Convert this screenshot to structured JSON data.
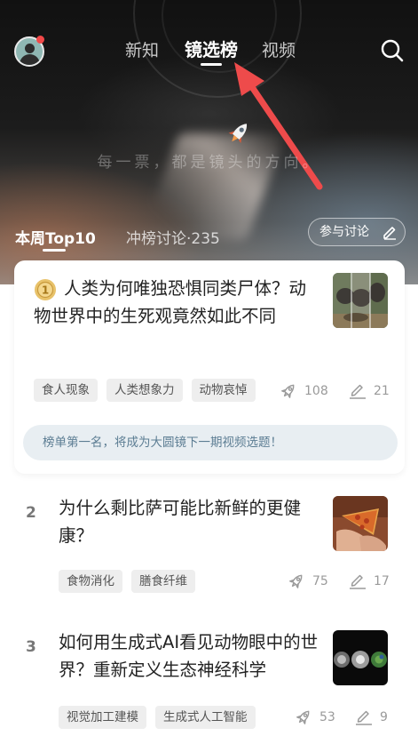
{
  "header": {
    "tabs": [
      {
        "label": "新知",
        "active": false
      },
      {
        "label": "镜选榜",
        "active": true
      },
      {
        "label": "视频",
        "active": false
      }
    ],
    "avatar_icon": "user-avatar",
    "search_icon": "search-icon"
  },
  "hero": {
    "slogan": "每一票，都是镜头的方向。"
  },
  "subtabs": {
    "main": "本周Top10",
    "second": "冲榜讨论·235",
    "join_button": "参与讨论"
  },
  "top_item": {
    "title": "人类为何唯独恐惧同类尸体？动物世界中的生死观竟然如此不同",
    "tags": [
      "食人现象",
      "人类想象力",
      "动物哀悼"
    ],
    "votes": "108",
    "comments": "21",
    "notice": "榜单第一名，将成为大圆镜下一期视频选题！"
  },
  "items": [
    {
      "rank": "2",
      "title": "为什么剩比萨可能比新鲜的更健康？",
      "tags": [
        "食物消化",
        "膳食纤维"
      ],
      "votes": "75",
      "comments": "17"
    },
    {
      "rank": "3",
      "title": "如何用生成式AI看见动物眼中的世界？重新定义生态神经科学",
      "tags": [
        "视觉加工建模",
        "生成式人工智能"
      ],
      "votes": "53",
      "comments": "9"
    }
  ],
  "colors": {
    "accent_red": "#ee4b4b",
    "notice_bg": "#e8eef2",
    "notice_text": "#5c7d93"
  }
}
